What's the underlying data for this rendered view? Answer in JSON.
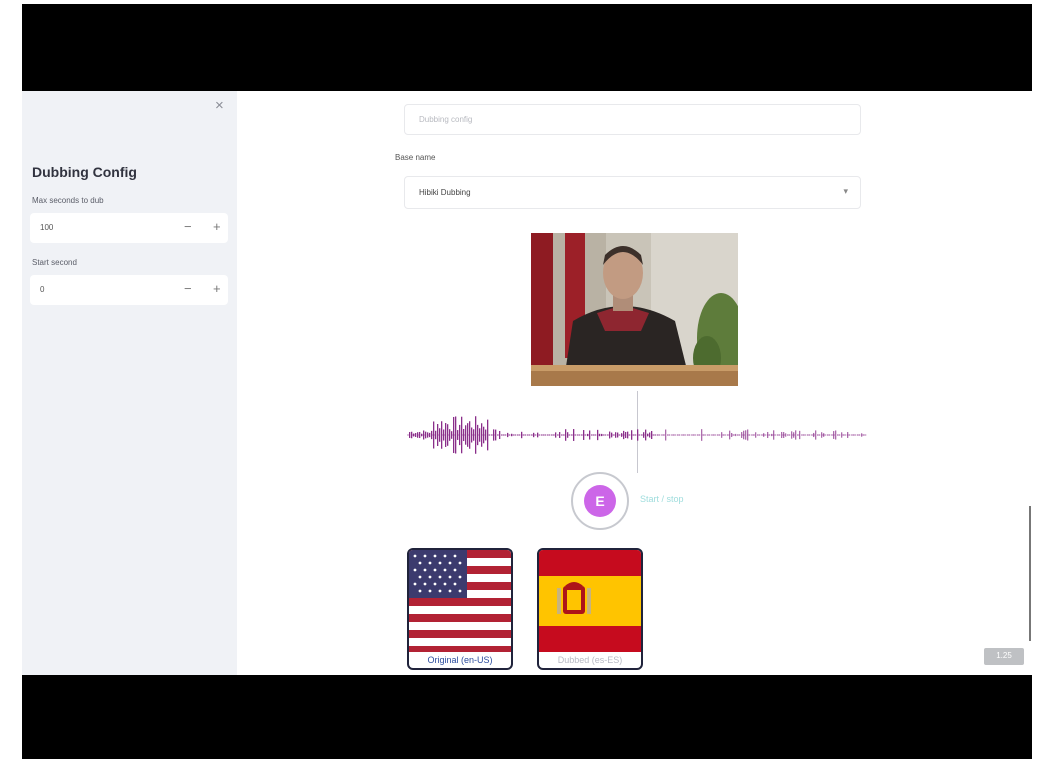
{
  "sidebar": {
    "close_symbol": "×",
    "title": "Dubbing Config",
    "max_seconds": {
      "label": "Max seconds to dub",
      "value": "100"
    },
    "start_second": {
      "label": "Start second",
      "value": "0"
    },
    "minus_symbol": "−",
    "plus_symbol": "+"
  },
  "main": {
    "top_input_placeholder": "Dubbing config",
    "voice_label": "Base name",
    "voice_select_value": "Hibiki Dubbing",
    "select_chevron": "▾",
    "player": {
      "button_letter": "E",
      "label": "Start / stop",
      "accent_color": "#cc66e8"
    },
    "languages": [
      {
        "caption": "Original (en-US)",
        "flag": "us-flag-icon",
        "caption_color": "#2c4d9e"
      },
      {
        "caption": "Dubbed (es-ES)",
        "flag": "spain-flag-icon",
        "caption_color": "#b8bac4"
      }
    ],
    "speed_badge": "1.25"
  },
  "colors": {
    "sidebar_bg": "#f0f2f6",
    "waveform": "#8a2e8a",
    "card_border": "#20233b"
  }
}
